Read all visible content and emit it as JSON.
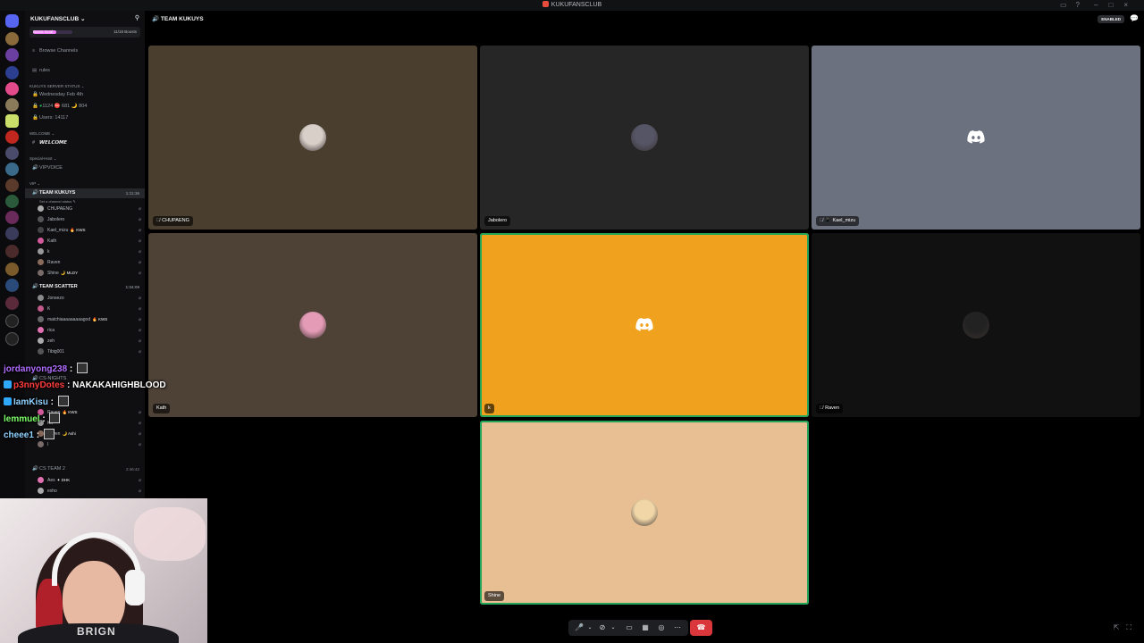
{
  "app": {
    "title": "KUKUFANSCLUB"
  },
  "titlebar": {
    "icons": [
      "inbox-icon",
      "help-icon"
    ],
    "window_controls": [
      "minimize-icon",
      "maximize-icon",
      "close-icon"
    ]
  },
  "sidebar": {
    "server_name": "KUKUFANSCLUB",
    "boost": {
      "label": "Boost Goal",
      "count": "11/18 Boosts",
      "progress": 0.6
    },
    "browse": "Browse Channels",
    "rules": "rules",
    "status_category": "KUKUYS SERVER STATUS",
    "status_date": "Wednesday Feb 4th",
    "status_counts": "1124 ⛔ 681 🌙 804",
    "status_users": "Users: 14117",
    "welcome_category": "WELCOME",
    "welcome_channel": "𝙒𝙀𝙇𝘾𝙊𝙈𝙀",
    "special_category": "Special-Host",
    "vip_voice": "VIPVOICE",
    "vip_category": "VIP",
    "team_kukuys": {
      "name": "TEAM KUKUYS",
      "time": "1:11:36",
      "status": "Set a channel status"
    },
    "kukuys_members": [
      {
        "name": "CHUPAENG",
        "tag": ""
      },
      {
        "name": "Jabolero",
        "tag": ""
      },
      {
        "name": "Kael_mizu",
        "tag": "🔥 KWS"
      },
      {
        "name": "Kath",
        "tag": ""
      },
      {
        "name": "k",
        "tag": ""
      },
      {
        "name": "Raven",
        "tag": ""
      },
      {
        "name": "Shine",
        "tag": "🌙 MLDY"
      }
    ],
    "team_scatter": {
      "name": "TEAM SCATTER",
      "time": "1:04:09"
    },
    "scatter_members": [
      {
        "name": "Jonsezo",
        "tag": ""
      },
      {
        "name": "K",
        "tag": ""
      },
      {
        "name": "matchiaaaaaaaaagod",
        "tag": "🔥 KWS"
      },
      {
        "name": "rica",
        "tag": ""
      },
      {
        "name": "zeh",
        "tag": ""
      },
      {
        "name": "Tibig001",
        "tag": ""
      }
    ],
    "cs_nights": "CS-NIGHTS",
    "cs_members": [
      {
        "name": "Raven",
        "tag": "🔥 KWS"
      },
      {
        "name": "Kit",
        "tag": ""
      },
      {
        "name": "Raven",
        "tag": "🌙 Ashi"
      },
      {
        "name": "I",
        "tag": ""
      }
    ],
    "cs_team2": {
      "name": "CS TEAM 2",
      "time": "2:46:42"
    },
    "cs2_members": [
      {
        "name": "Aes",
        "tag": "✦ DHK"
      },
      {
        "name": "exho",
        "tag": ""
      }
    ]
  },
  "voice_header": {
    "title": "TEAM KUKUYS",
    "enabled": "ENABLED"
  },
  "tiles": [
    {
      "name": "CHUPAENG",
      "bg": "#4a3f2f",
      "avatar": "photo",
      "mic": "🎙̸",
      "speaking": false
    },
    {
      "name": "Jabolero",
      "bg": "#262626",
      "avatar": "photo",
      "mic": "",
      "speaking": false
    },
    {
      "name": "Kael_mizu",
      "bg": "#6b717f",
      "avatar": "discord",
      "mic": "🎙̸ 📱",
      "speaking": false
    },
    {
      "name": "Kath",
      "bg": "#4e4236",
      "avatar": "photo",
      "mic": "",
      "speaking": false
    },
    {
      "name": "k",
      "bg": "#f0a21e",
      "avatar": "discord",
      "mic": "",
      "speaking": true
    },
    {
      "name": "Raven",
      "bg": "#111111",
      "avatar": "photo",
      "mic": "🎙̸",
      "speaking": false
    },
    {
      "name": "Shine",
      "bg": "#e7bf93",
      "avatar": "photo",
      "mic": "",
      "speaking": true
    }
  ],
  "chat": [
    {
      "user": "jordanyong238",
      "color": "#b06cff",
      "msg": "",
      "emote": true,
      "badge": ""
    },
    {
      "user": "p3nnyDotes",
      "color": "#ff3b3b",
      "msg": "NAKAKAHIGHBLOOD",
      "emote": false,
      "badge": "#2fa8ff"
    },
    {
      "user": "IamKisu",
      "color": "#8fd1ff",
      "msg": "",
      "emote": true,
      "badge": "#2fa8ff"
    },
    {
      "user": "lemmuel",
      "color": "#7dff6a",
      "msg": "",
      "emote": true,
      "badge": ""
    },
    {
      "user": "cheee1",
      "color": "#8fd1ff",
      "msg": "",
      "emote": true,
      "badge": ""
    }
  ],
  "webcam": {
    "caption": "BRIGN"
  }
}
